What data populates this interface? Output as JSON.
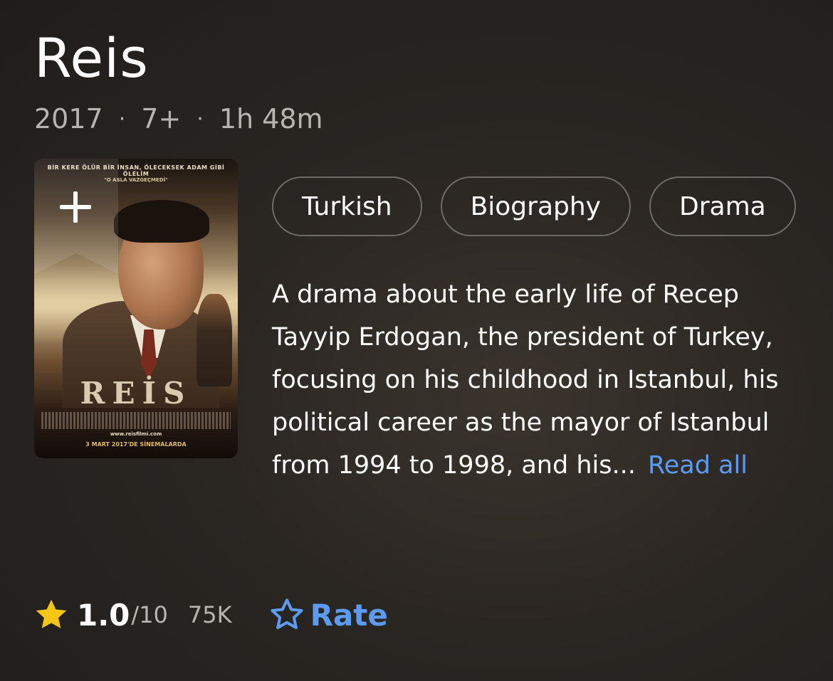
{
  "title": "Reis",
  "meta": {
    "year": "2017",
    "separator": "·",
    "rating_cert": "7+",
    "runtime": "1h 48m"
  },
  "poster": {
    "tagline": "BİR KERE ÖLÜR BİR İNSAN, ÖLECEKSEK ADAM GİBİ ÖLELİM",
    "tagline2": "\"O ASLA VAZGEÇMEDİ\"",
    "title": "REİS",
    "url": "www.reisfilmi.com",
    "release": "3 MART 2017'DE SİNEMALARDA",
    "add_icon": "plus-icon"
  },
  "genres": [
    "Turkish",
    "Biography",
    "Drama"
  ],
  "description": {
    "text": "A drama about the early life of Recep Tayyip Erdogan, the president of Turkey, focusing on his childhood in Istanbul, his political career as the mayor of Istanbul from 1994 to 1998, and his...",
    "read_all": "Read all"
  },
  "rating": {
    "icon": "star-filled-icon",
    "score": "1.0",
    "out_of": "/10",
    "votes": "75K"
  },
  "rate": {
    "icon": "star-outline-icon",
    "label": "Rate"
  },
  "colors": {
    "accent": "#5b9bf3",
    "star": "#f5c518",
    "muted_text": "#b8b5b1"
  }
}
